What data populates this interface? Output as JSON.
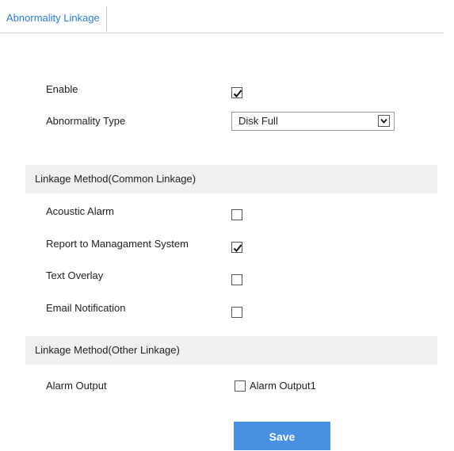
{
  "tabs": [
    {
      "label": "Abnormality Linkage",
      "active": true
    }
  ],
  "form": {
    "enable_label": "Enable",
    "enable_checked": true,
    "abnormality_type_label": "Abnormality Type",
    "abnormality_type_value": "Disk Full"
  },
  "common_linkage": {
    "title": "Linkage Method(Common Linkage)",
    "items": [
      {
        "label": "Acoustic Alarm",
        "checked": false
      },
      {
        "label": "Report to Managament System",
        "checked": true
      },
      {
        "label": "Text Overlay",
        "checked": false
      },
      {
        "label": "Email Notification",
        "checked": false
      }
    ]
  },
  "other_linkage": {
    "title": "Linkage Method(Other Linkage)",
    "alarm_output_label": "Alarm Output",
    "alarm_output_option": "Alarm Output1",
    "alarm_output_checked": false
  },
  "save_label": "Save",
  "colors": {
    "accent": "#4a90e2",
    "tab_text": "#2a7fd4",
    "section_bg": "#f0f0f0"
  }
}
